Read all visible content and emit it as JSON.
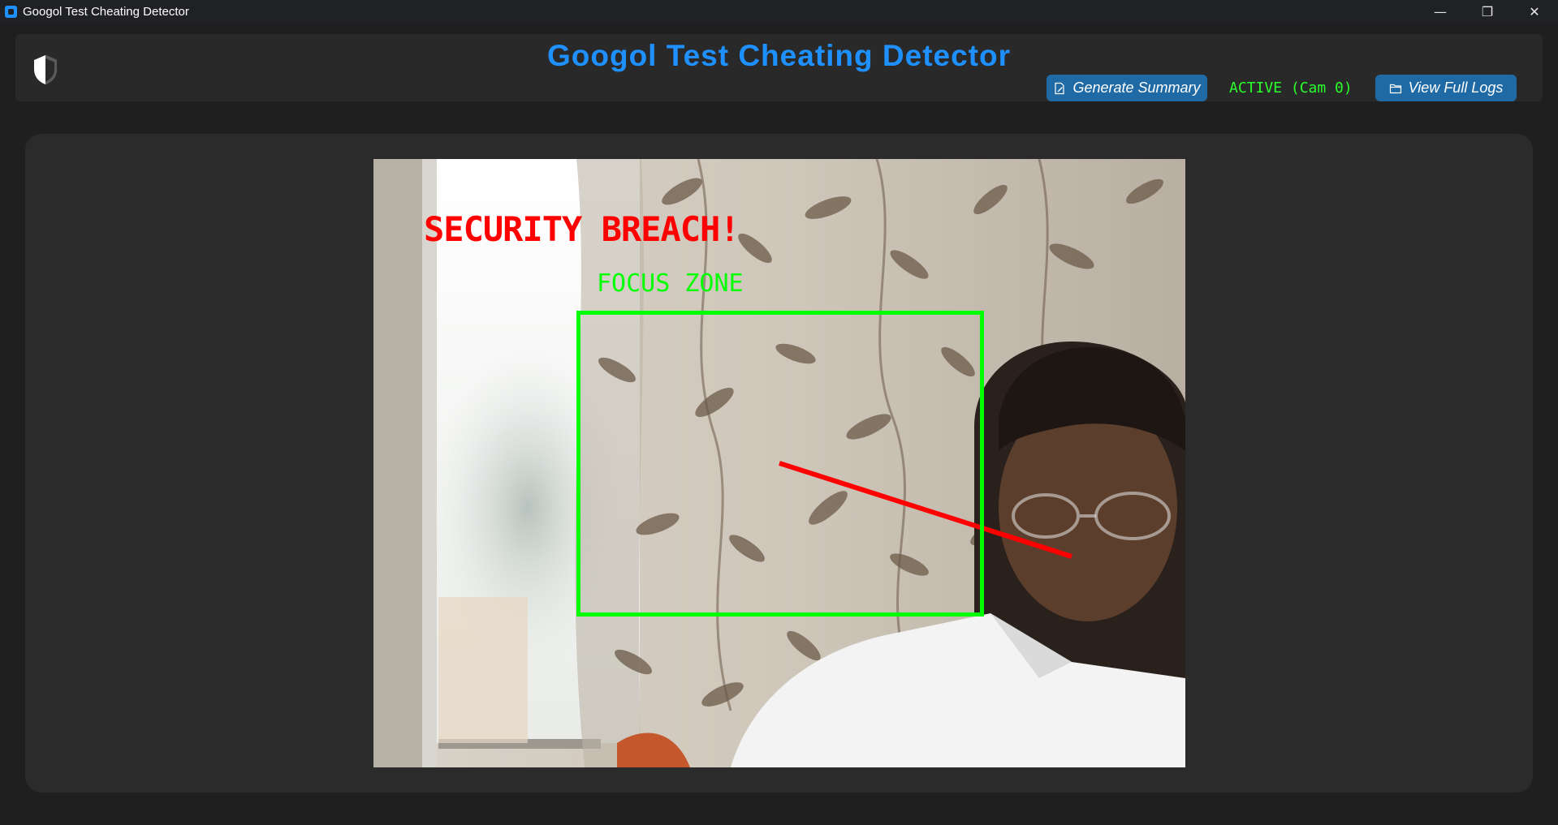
{
  "window": {
    "title": "Googol Test Cheating Detector",
    "minimize_glyph": "—",
    "restore_glyph": "❐",
    "close_glyph": "✕"
  },
  "header": {
    "app_title": "Googol Test Cheating Detector",
    "generate_summary_label": "Generate Summary",
    "status_text": "ACTIVE (Cam 0)",
    "view_logs_label": "View Full Logs",
    "logo_icon": "shield-icon"
  },
  "feed": {
    "breach_text": "SECURITY BREACH!",
    "focus_zone_label": "FOCUS ZONE"
  },
  "colors": {
    "title_blue": "#1e90ff",
    "button_blue": "#1f6aa5",
    "status_green": "#2bff2b",
    "breach_red": "#ff0000",
    "focus_green": "#00ff00"
  }
}
